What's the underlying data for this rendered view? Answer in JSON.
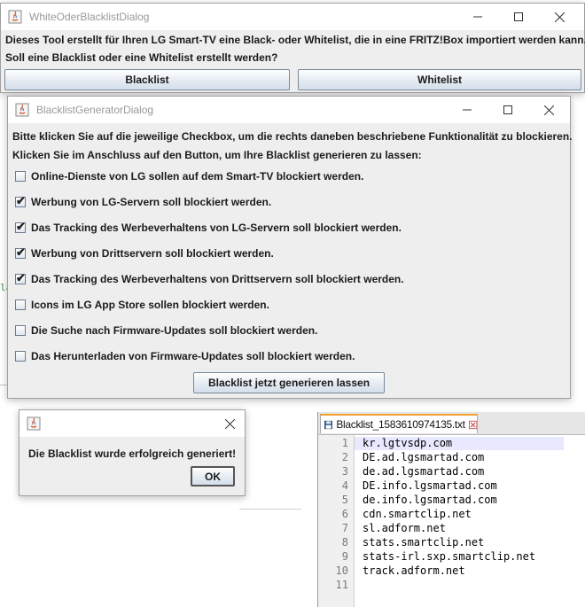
{
  "dialog1": {
    "title": "WhiteOderBlacklistDialog",
    "text1": "Dieses Tool erstellt für Ihren LG Smart-TV eine Black- oder Whitelist, die in eine FRITZ!Box importiert werden kann.",
    "text2": "Soll eine Blacklist oder eine Whitelist erstellt werden?",
    "btn_blacklist": "Blacklist",
    "btn_whitelist": "Whitelist"
  },
  "dialog2": {
    "title": "BlacklistGeneratorDialog",
    "text1": "Bitte klicken Sie auf die jeweilige Checkbox, um die rechts daneben beschriebene Funktionalität zu blockieren.",
    "text2": "Klicken Sie im Anschluss auf den Button, um Ihre Blacklist generieren zu lassen:",
    "options": [
      {
        "label": "Online-Dienste von LG sollen auf dem Smart-TV blockiert werden.",
        "checked": false
      },
      {
        "label": "Werbung von LG-Servern soll blockiert werden.",
        "checked": true
      },
      {
        "label": "Das Tracking des Werbeverhaltens von LG-Servern soll blockiert werden.",
        "checked": true
      },
      {
        "label": "Werbung von Drittservern soll blockiert werden.",
        "checked": true
      },
      {
        "label": "Das Tracking des Werbeverhaltens von Drittservern soll blockiert werden.",
        "checked": true
      },
      {
        "label": "Icons im LG App Store sollen blockiert werden.",
        "checked": false
      },
      {
        "label": "Die Suche nach Firmware-Updates soll blockiert werden.",
        "checked": false
      },
      {
        "label": "Das Herunterladen von Firmware-Updates soll blockiert werden.",
        "checked": false
      }
    ],
    "check_mark": "✔",
    "generate_button": "Blacklist jetzt generieren lassen"
  },
  "dialog3": {
    "message": "Die Blacklist wurde erfolgreich generiert!",
    "ok": "OK"
  },
  "editor": {
    "tab_name": "Blacklist_1583610974135.txt",
    "lines": [
      "kr.lgtvsdp.com",
      "DE.ad.lgsmartad.com",
      "de.ad.lgsmartad.com",
      "DE.info.lgsmartad.com",
      "de.info.lgsmartad.com",
      "cdn.smartclip.net",
      "sl.adform.net",
      "stats.smartclip.net",
      "stats-irl.sxp.smartclip.net",
      "track.adform.net",
      ""
    ],
    "line_numbers": [
      "1",
      "2",
      "3",
      "4",
      "5",
      "6",
      "7",
      "8",
      "9",
      "10",
      "11"
    ]
  },
  "background_fragment": "la",
  "colors": {
    "button_border": "#7a8a99",
    "dialog_bg": "#eeeeee",
    "tab_accent": "#f0a030",
    "current_line": "#e8e8ff"
  }
}
